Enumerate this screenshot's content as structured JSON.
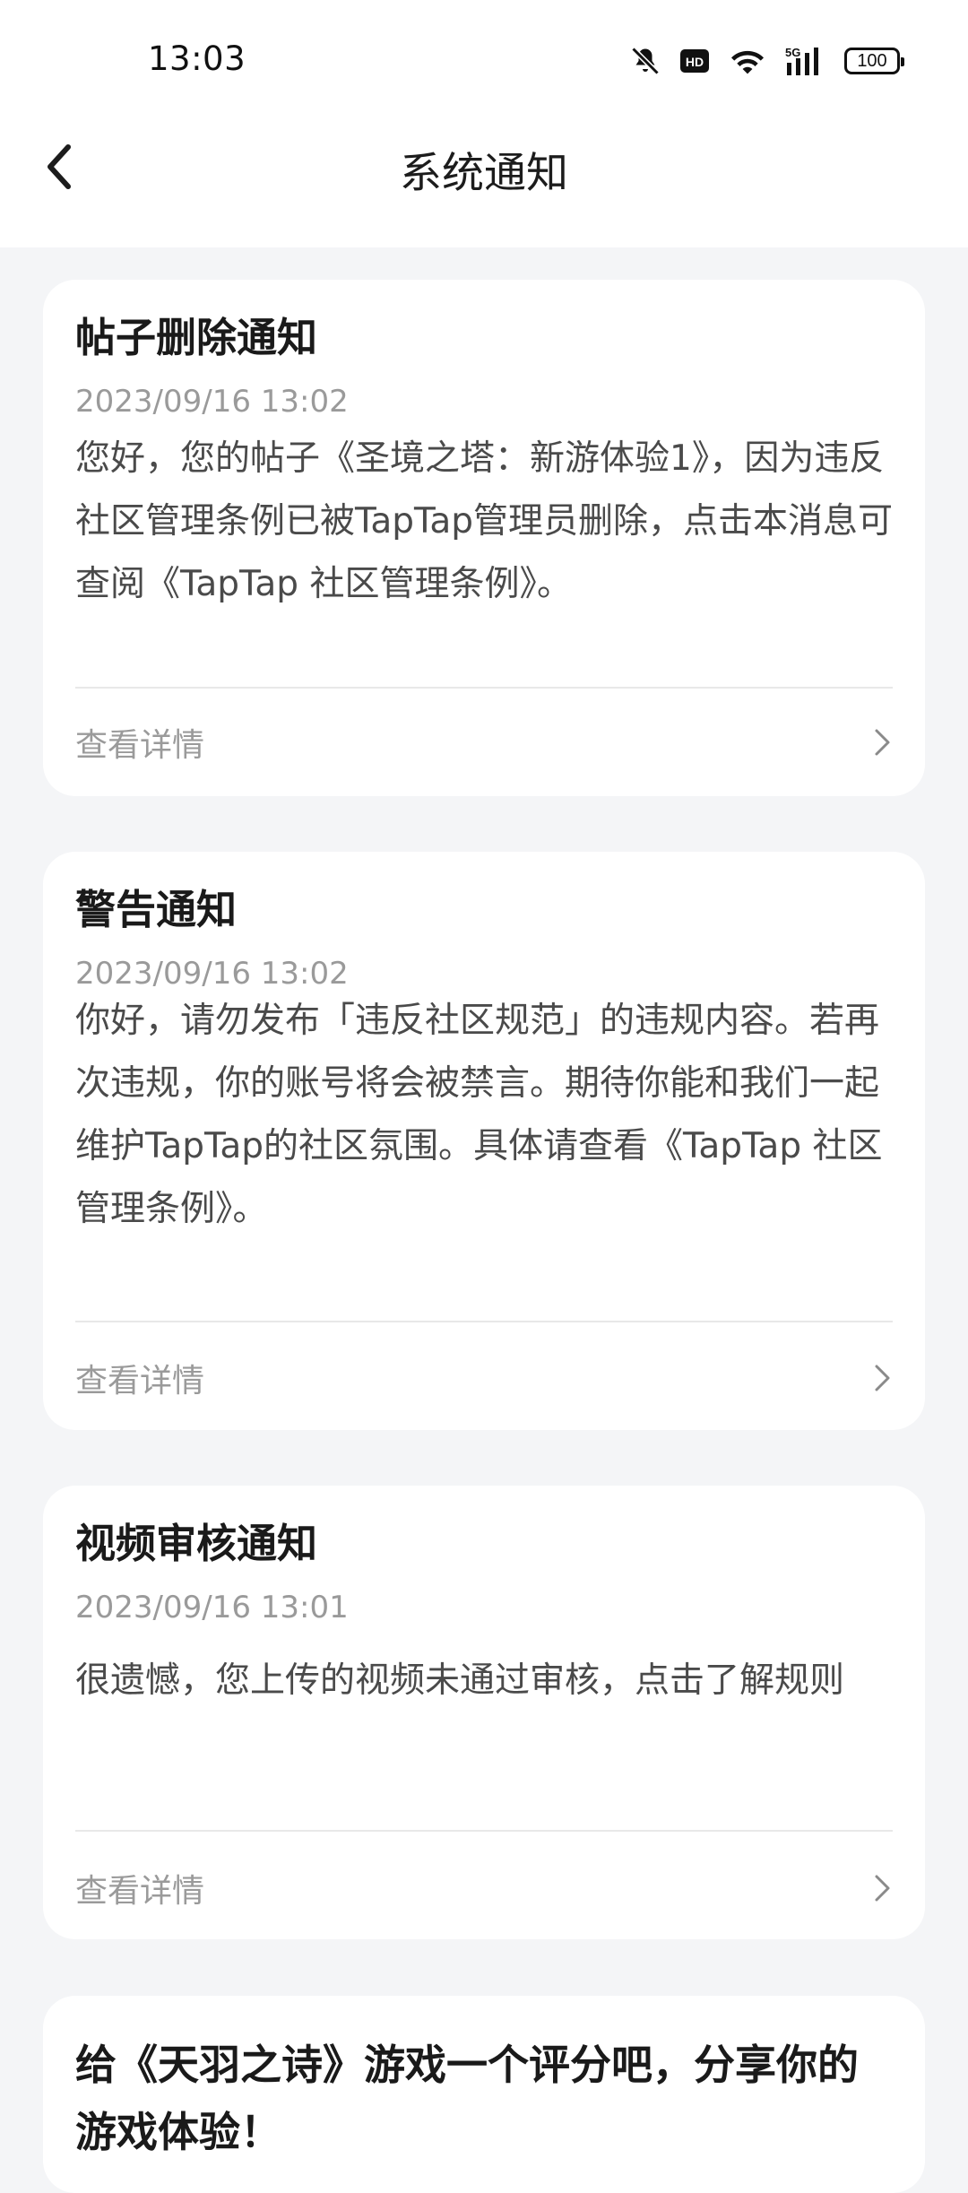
{
  "status_bar": {
    "time": "13:03",
    "battery": "100",
    "icons": [
      "mute-bell-icon",
      "hd-icon",
      "wifi-icon",
      "5g-signal-icon",
      "battery-icon"
    ]
  },
  "nav": {
    "title": "系统通知",
    "back_icon": "chevron-left-icon"
  },
  "notifications": [
    {
      "title": "帖子删除通知",
      "time": "2023/09/16 13:02",
      "body": "您好，您的帖子《圣境之塔：新游体验1》，因为违反社区管理条例已被TapTap管理员删除，点击本消息可查阅《TapTap 社区管理条例》。",
      "detail_label": "查看详情"
    },
    {
      "title": "警告通知",
      "time": "2023/09/16 13:02",
      "body": "你好，请勿发布「违反社区规范」的违规内容。若再次违规，你的账号将会被禁言。期待你能和我们一起维护TapTap的社区氛围。具体请查看《TapTap 社区管理条例》。",
      "detail_label": "查看详情"
    },
    {
      "title": "视频审核通知",
      "time": "2023/09/16 13:01",
      "body": "很遗憾，您上传的视频未通过审核，点击了解规则",
      "detail_label": "查看详情"
    },
    {
      "title": "给《天羽之诗》游戏一个评分吧，分享你的游戏体验！"
    }
  ],
  "colors": {
    "background": "#f4f5f7",
    "card": "#ffffff",
    "title_text": "#1a1a1a",
    "body_text": "#4a4a4a",
    "muted_text": "#9a9a9a"
  }
}
